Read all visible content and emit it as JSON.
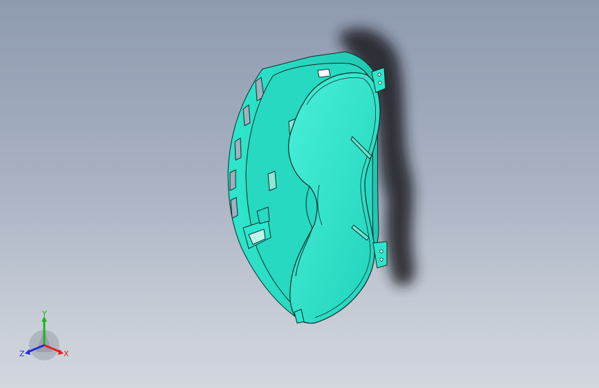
{
  "viewport": {
    "background_top": "#8e9aaf",
    "background_bottom": "#d3d7de"
  },
  "model": {
    "body_color": "#2ee6cc",
    "shade_color": "#22c3ad",
    "edge_color": "#0b2a26",
    "shadow_color": "#1a1d22"
  },
  "triad": {
    "x_label": "X",
    "y_label": "Y",
    "z_label": "Z",
    "x_color": "#e02020",
    "y_color": "#18b818",
    "z_color": "#2030d8"
  }
}
